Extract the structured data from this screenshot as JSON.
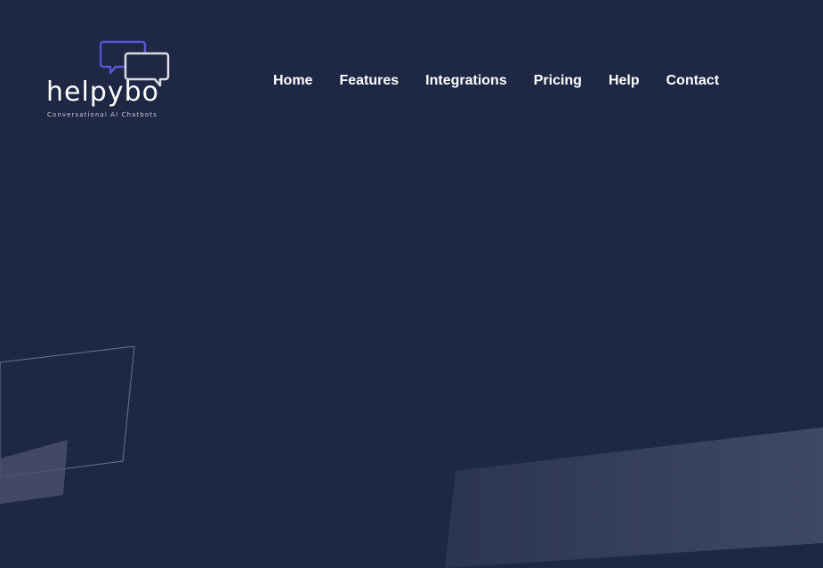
{
  "logo": {
    "wordmark": "helpybo",
    "tagline": "Conversational AI Chatbots",
    "icon": "chat-bubbles-icon",
    "colors": {
      "bubble_front": "#5b55d6",
      "bubble_back": "#d9dbe3"
    }
  },
  "nav": {
    "items": [
      {
        "label": "Home"
      },
      {
        "label": "Features"
      },
      {
        "label": "Integrations"
      },
      {
        "label": "Pricing"
      },
      {
        "label": "Help"
      },
      {
        "label": "Contact"
      }
    ]
  },
  "theme": {
    "background": "#1e2744",
    "nav_text": "#ffffff",
    "shape_fill": "#3a4460",
    "shape_outline": "#6b7390"
  }
}
